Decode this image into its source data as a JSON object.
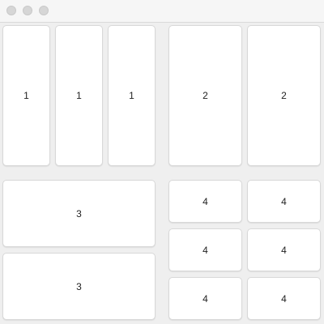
{
  "window": {
    "title": ""
  },
  "tiles": {
    "row1": [
      "1",
      "1",
      "1",
      "2",
      "2"
    ],
    "row2_left": [
      "3",
      "3"
    ],
    "row2_right": [
      "4",
      "4",
      "4",
      "4",
      "4",
      "4"
    ]
  }
}
